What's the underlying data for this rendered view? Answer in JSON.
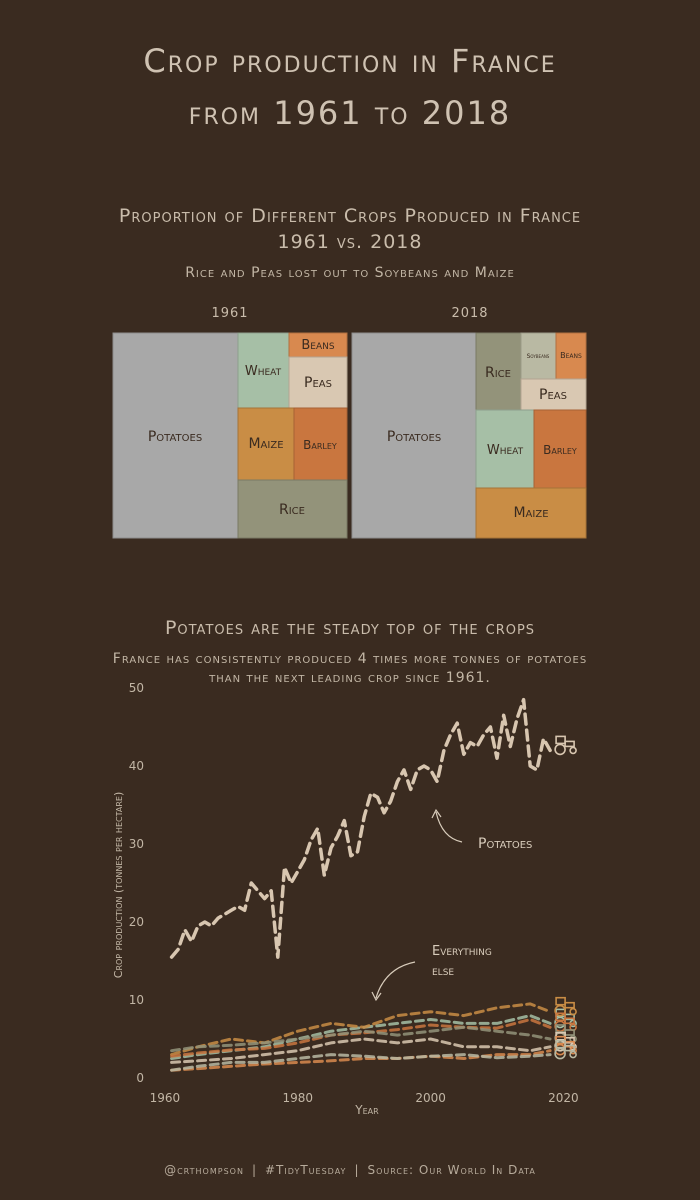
{
  "page": {
    "title_line1": "Crop production in France",
    "title_line2": "from 1961 to 2018"
  },
  "treemap": {
    "title_line1": "Proportion of Different Crops Produced in France",
    "title_line2": "1961 vs. 2018",
    "subtitle": "Rice and Peas lost out to Soybeans and Maize"
  },
  "linechart": {
    "title": "Potatoes are the steady top of the crops",
    "subtitle_line1": "France has consistently produced 4 times more tonnes of potatoes",
    "subtitle_line2": "than the next leading crop since 1961.",
    "annotation_potatoes": "Potatoes",
    "annotation_else_1": "Everything",
    "annotation_else_2": "else"
  },
  "footer": {
    "handle": "@crthompson",
    "tag": "#TidyTuesday",
    "source": "Source: Our World In Data"
  },
  "colors": {
    "background": "#3a2b20",
    "potatoes": "#a8a8a8",
    "wheat": "#a6bfa6",
    "beans": "#d8894f",
    "peas": "#d9c8b2",
    "maize": "#c98d45",
    "barley": "#c9763f",
    "rice": "#93937a",
    "soybeans": "#b9b9a3",
    "potato_line": "#d8c6b0"
  },
  "chart_data": [
    {
      "type": "treemap",
      "panels": [
        {
          "label": "1961",
          "tiles": [
            "Potatoes",
            "Wheat",
            "Beans",
            "Peas",
            "Maize",
            "Barley",
            "Rice"
          ],
          "shares": [
            0.53,
            0.09,
            0.04,
            0.07,
            0.1,
            0.1,
            0.17
          ]
        },
        {
          "label": "2018",
          "tiles": [
            "Potatoes",
            "Rice",
            "Soybeans",
            "Beans",
            "Peas",
            "Wheat",
            "Barley",
            "Maize"
          ],
          "shares": [
            0.53,
            0.09,
            0.03,
            0.02,
            0.04,
            0.1,
            0.1,
            0.11
          ]
        }
      ]
    },
    {
      "type": "line",
      "xlabel": "Year",
      "ylabel": "Crop production (tonnes per hectare)",
      "xlim": [
        1957,
        2024
      ],
      "ylim": [
        0,
        50
      ],
      "xticks": [
        1960,
        1980,
        2000,
        2020
      ],
      "yticks": [
        0,
        10,
        20,
        30,
        40,
        50
      ],
      "series": [
        {
          "name": "Potatoes",
          "x": [
            1961,
            1962,
            1963,
            1964,
            1965,
            1966,
            1967,
            1968,
            1969,
            1970,
            1971,
            1972,
            1973,
            1974,
            1975,
            1976,
            1977,
            1978,
            1979,
            1980,
            1981,
            1982,
            1983,
            1984,
            1985,
            1986,
            1987,
            1988,
            1989,
            1990,
            1991,
            1992,
            1993,
            1994,
            1995,
            1996,
            1997,
            1998,
            1999,
            2000,
            2001,
            2002,
            2003,
            2004,
            2005,
            2006,
            2007,
            2008,
            2009,
            2010,
            2011,
            2012,
            2013,
            2014,
            2015,
            2016,
            2017,
            2018
          ],
          "values": [
            15.5,
            16.5,
            19.0,
            17.5,
            19.5,
            20.0,
            19.5,
            20.5,
            21.0,
            21.5,
            22.0,
            21.5,
            25.0,
            24.0,
            23.0,
            24.0,
            15.5,
            27.0,
            25.0,
            26.5,
            28.0,
            30.5,
            32.0,
            26.0,
            29.5,
            31.0,
            33.0,
            28.5,
            29.0,
            33.5,
            36.5,
            36.0,
            34.0,
            35.5,
            38.0,
            39.5,
            37.0,
            39.5,
            40.0,
            39.5,
            38.0,
            42.0,
            44.0,
            45.5,
            41.5,
            43.0,
            42.5,
            44.0,
            45.0,
            41.0,
            46.5,
            42.5,
            46.0,
            48.5,
            40.0,
            39.5,
            43.5,
            42.0
          ]
        },
        {
          "name": "Wheat",
          "x": [
            1961,
            1965,
            1970,
            1975,
            1980,
            1985,
            1990,
            1995,
            2000,
            2005,
            2010,
            2015,
            2018
          ],
          "values": [
            2.5,
            3.0,
            3.5,
            4.0,
            5.0,
            6.0,
            6.5,
            7.0,
            7.5,
            7.0,
            7.0,
            8.0,
            7.0
          ]
        },
        {
          "name": "Maize",
          "x": [
            1961,
            1965,
            1970,
            1975,
            1980,
            1985,
            1990,
            1995,
            2000,
            2005,
            2010,
            2015,
            2018
          ],
          "values": [
            3.0,
            4.0,
            5.0,
            4.5,
            6.0,
            7.0,
            6.5,
            8.0,
            8.5,
            8.0,
            9.0,
            9.5,
            8.5
          ]
        },
        {
          "name": "Barley",
          "x": [
            1961,
            1965,
            1970,
            1975,
            1980,
            1985,
            1990,
            1995,
            2000,
            2005,
            2010,
            2015,
            2018
          ],
          "values": [
            2.8,
            3.2,
            3.6,
            3.8,
            4.5,
            5.5,
            5.8,
            6.2,
            6.8,
            6.5,
            6.4,
            7.5,
            6.5
          ]
        },
        {
          "name": "Rice",
          "x": [
            1961,
            1965,
            1970,
            1975,
            1980,
            1985,
            1990,
            1995,
            2000,
            2005,
            2010,
            2015,
            2018
          ],
          "values": [
            3.5,
            4.0,
            4.2,
            4.5,
            5.0,
            5.5,
            6.0,
            5.5,
            6.0,
            6.5,
            6.0,
            5.5,
            5.0
          ]
        },
        {
          "name": "Peas",
          "x": [
            1961,
            1965,
            1970,
            1975,
            1980,
            1985,
            1990,
            1995,
            2000,
            2005,
            2010,
            2015,
            2018
          ],
          "values": [
            2.0,
            2.2,
            2.5,
            3.0,
            3.5,
            4.5,
            5.0,
            4.5,
            5.0,
            4.0,
            4.0,
            3.5,
            4.0
          ]
        },
        {
          "name": "Beans",
          "x": [
            1961,
            1965,
            1970,
            1975,
            1980,
            1985,
            1990,
            1995,
            2000,
            2005,
            2010,
            2015,
            2018
          ],
          "values": [
            1.0,
            1.2,
            1.5,
            1.8,
            2.0,
            2.2,
            2.5,
            2.5,
            2.8,
            2.5,
            3.0,
            3.0,
            3.5
          ]
        },
        {
          "name": "Soybeans",
          "x": [
            1961,
            1965,
            1970,
            1975,
            1980,
            1985,
            1990,
            1995,
            2000,
            2005,
            2010,
            2015,
            2018
          ],
          "values": [
            1.0,
            1.5,
            2.0,
            2.0,
            2.5,
            3.0,
            2.8,
            2.5,
            2.8,
            3.0,
            2.6,
            2.8,
            3.0
          ]
        }
      ]
    }
  ]
}
